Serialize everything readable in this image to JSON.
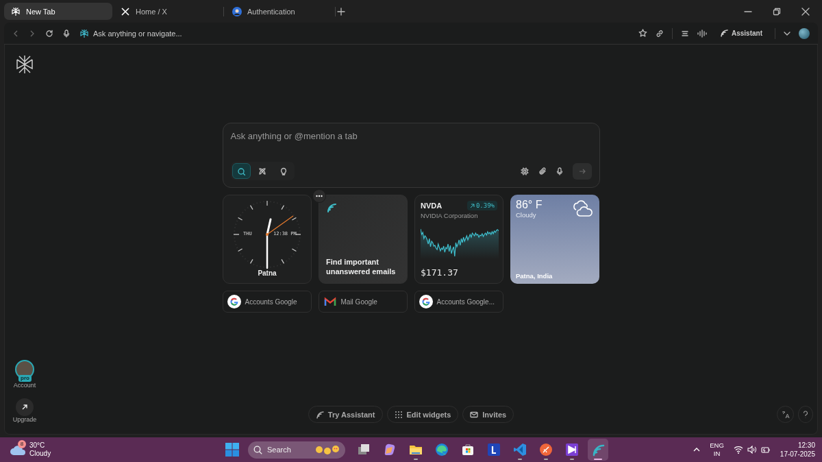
{
  "tabs": [
    {
      "label": "New Tab",
      "kind": "perplexity",
      "selected": true
    },
    {
      "label": "Home / X",
      "kind": "x",
      "selected": false
    },
    {
      "label": "Authentication",
      "kind": "avatar",
      "selected": false
    }
  ],
  "toolbar": {
    "address_placeholder": "Ask anything or navigate...",
    "assistant_label": "Assistant"
  },
  "prompt": {
    "placeholder": "Ask anything or @mention a tab",
    "modes": [
      {
        "kind": "search",
        "selected": true
      },
      {
        "kind": "research",
        "selected": false
      },
      {
        "kind": "labs",
        "selected": false
      }
    ]
  },
  "widgets": {
    "clock": {
      "day": "THU",
      "time": "12:38 PM",
      "city": "Patna"
    },
    "email": {
      "text": "Find important unanswered emails"
    },
    "stock": {
      "ticker": "NVDA",
      "change": "0.39%",
      "company": "NVIDIA Corporation",
      "price": "$171.37"
    },
    "weather": {
      "temperature": "86° F",
      "condition": "Cloudy",
      "location": "Patna, India"
    }
  },
  "shortcuts": [
    {
      "label": "Accounts Google",
      "kind": "google"
    },
    {
      "label": "Mail Google",
      "kind": "gmail"
    },
    {
      "label": "Accounts Google...",
      "kind": "google"
    }
  ],
  "sidebar": {
    "badge": "pro",
    "account_label": "Account",
    "upgrade_label": "Upgrade"
  },
  "bottom_actions": [
    {
      "label": "Try Assistant",
      "kind": "assistant"
    },
    {
      "label": "Edit widgets",
      "kind": "grid"
    },
    {
      "label": "Invites",
      "kind": "mail"
    }
  ],
  "taskbar": {
    "weather": {
      "badge": "8",
      "temperature": "30°C",
      "condition": "Cloudy"
    },
    "search_placeholder": "Search",
    "apps": [
      {
        "kind": "taskview",
        "running": false,
        "selected": false
      },
      {
        "kind": "copilot",
        "running": false,
        "selected": false
      },
      {
        "kind": "folder",
        "running": true,
        "selected": false
      },
      {
        "kind": "edge",
        "running": false,
        "selected": false
      },
      {
        "kind": "store",
        "running": false,
        "selected": false
      },
      {
        "kind": "letter",
        "running": false,
        "selected": false
      },
      {
        "kind": "code",
        "running": true,
        "selected": false
      },
      {
        "kind": "rocket",
        "running": true,
        "selected": false
      },
      {
        "kind": "studio",
        "running": true,
        "selected": false
      },
      {
        "kind": "perplexity",
        "running": true,
        "selected": true
      }
    ],
    "language": "ENG",
    "region": "IN",
    "time": "12:30",
    "date": "17-07-2025"
  }
}
